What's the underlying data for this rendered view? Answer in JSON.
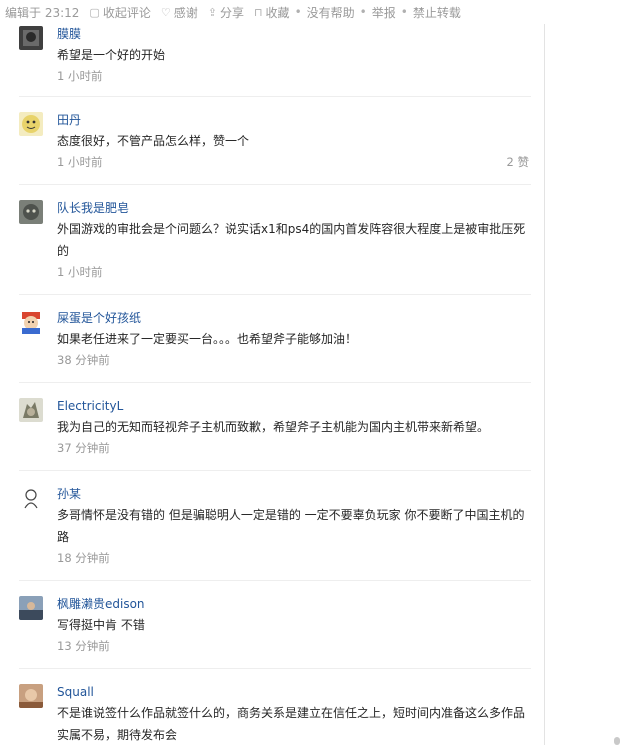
{
  "topbar": {
    "edited": "编辑于 23:12",
    "collapse": "收起评论",
    "thanks": "感谢",
    "share": "分享",
    "favorite": "收藏",
    "dot": "•",
    "no_help": "没有帮助",
    "report": "举报",
    "no_repost": "禁止转载"
  },
  "comments": [
    {
      "name": "膜膜",
      "text": "希望是一个好的开始",
      "time": "1 小时前",
      "likes": "",
      "avatar_color": "#4b4b4b"
    },
    {
      "name": "田丹",
      "text": "态度很好，不管产品怎么样，赞一个",
      "time": "1 小时前",
      "likes": "2 赞",
      "avatar_color": "#e8d36a"
    },
    {
      "name": "队长我是肥皂",
      "text": "外国游戏的审批会是个问题么？说实话x1和ps4的国内首发阵容很大程度上是被审批压死的",
      "time": "1 小时前",
      "likes": "",
      "avatar_color": "#6a6f68"
    },
    {
      "name": "屎蛋是个好孩纸",
      "text": "如果老任进来了一定要买一台。。。也希望斧子能够加油！",
      "time": "38 分钟前",
      "likes": "",
      "avatar_color": "#d9452f"
    },
    {
      "name": "ElectricityL",
      "text": "我为自己的无知而轻视斧子主机而致歉，希望斧子主机能为国内主机带来新希望。",
      "time": "37 分钟前",
      "likes": "",
      "avatar_color": "#8a8a7a"
    },
    {
      "name": "孙某",
      "text": "多哥情怀是没有错的 但是骗聪明人一定是错的 一定不要辜负玩家 你不要断了中国主机的路",
      "time": "18 分钟前",
      "likes": "",
      "avatar_color": "#f2f2f2"
    },
    {
      "name": "枫雕濑贵edison",
      "text": "写得挺中肯 不错",
      "time": "13 分钟前",
      "likes": "",
      "avatar_color": "#5b6b7e"
    },
    {
      "name": "Squall",
      "text": "不是谁说签什么作品就签什么的，商务关系是建立在信任之上，短时间内准备这么多作品实属不易，期待发布会",
      "time": "",
      "likes": "",
      "avatar_color": "#b98a6a"
    }
  ]
}
